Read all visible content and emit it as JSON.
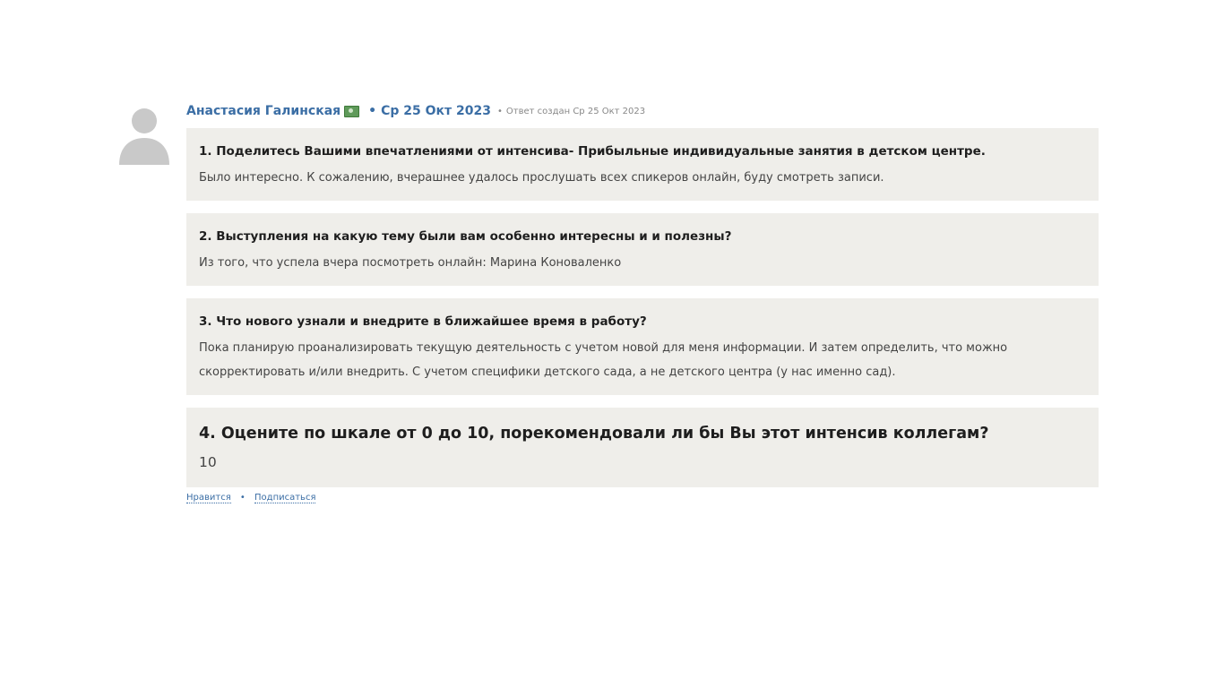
{
  "post": {
    "author": "Анастасия Галинская",
    "badge_icon": "money-icon",
    "date": "Ср 25 Окт 2023",
    "created_label": "Ответ создан Ср 25 Окт 2023"
  },
  "qa": [
    {
      "question": "1. Поделитесь Вашими впечатлениями от интенсива- Прибыльные индивидуальные занятия в детском центре.",
      "answer": "Было интересно. К сожалению, вчерашнее удалось прослушать всех спикеров онлайн, буду смотреть записи."
    },
    {
      "question": "2. Выступления на какую тему были вам особенно интересны и и полезны?",
      "answer": "Из того, что успела вчера посмотреть онлайн: Марина Коноваленко"
    },
    {
      "question": "3. Что нового узнали и внедрите в ближайшее время в работу?",
      "answer": "Пока планирую проанализировать текущую деятельность с учетом новой для меня информации. И затем определить, что можно скорректировать и/или внедрить. С учетом специфики детского сада, а не детского центра (у нас именно сад)."
    },
    {
      "question": "4. Оцените по шкале от 0 до 10, порекомендовали ли бы Вы этот интенсив коллегам?",
      "answer": "10"
    }
  ],
  "actions": {
    "like_label": "Нравится",
    "separator": "•",
    "subscribe_label": "Подписаться"
  },
  "colors": {
    "link": "#3b6ea5",
    "block_bg": "#efeeea",
    "muted": "#888888"
  }
}
